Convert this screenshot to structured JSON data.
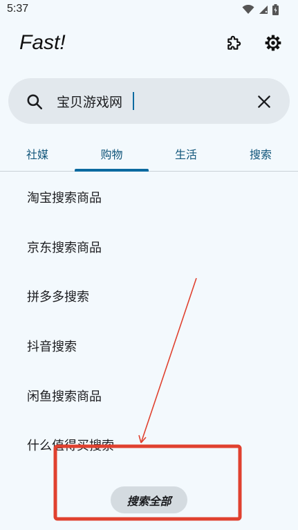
{
  "status_bar": {
    "time": "5:37"
  },
  "app": {
    "title": "Fast!"
  },
  "search": {
    "value": "宝贝游戏网"
  },
  "tabs": [
    {
      "label": "社媒"
    },
    {
      "label": "购物"
    },
    {
      "label": "生活"
    },
    {
      "label": "搜索"
    }
  ],
  "active_tab": "购物",
  "results": [
    {
      "label": "淘宝搜索商品"
    },
    {
      "label": "京东搜索商品"
    },
    {
      "label": "拼多多搜索"
    },
    {
      "label": "抖音搜索"
    },
    {
      "label": "闲鱼搜索商品"
    },
    {
      "label": "什么值得买搜索"
    }
  ],
  "footer": {
    "search_all_label": "搜索全部"
  },
  "icons": {
    "wifi": "wifi-icon",
    "signal": "signal-icon",
    "battery": "battery-icon",
    "extension": "puzzle-icon",
    "settings": "gear-icon",
    "search": "search-icon",
    "clear": "close-icon"
  },
  "colors": {
    "accent": "#0b6aa0",
    "tab_text": "#10557a",
    "annotation": "#e0412f",
    "background": "#f3f9fd"
  }
}
